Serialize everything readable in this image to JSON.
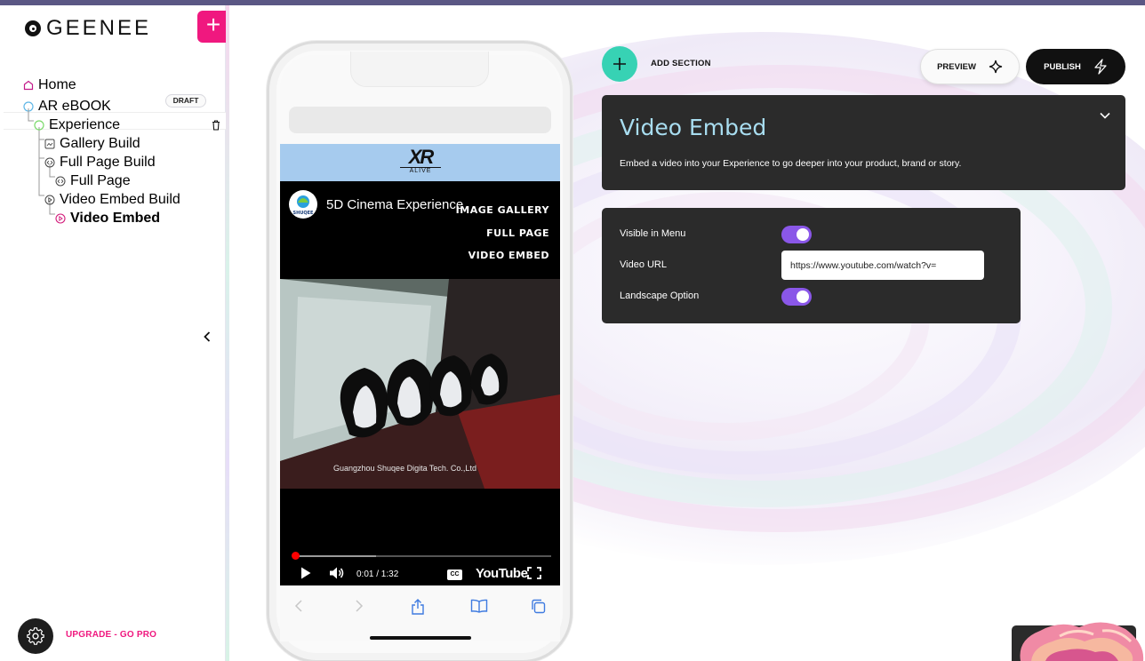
{
  "app": {
    "brand": "GEENEE",
    "add_label": "+"
  },
  "sidebar": {
    "tree": [
      {
        "label": "Home",
        "icon": "home-icon",
        "level": 0
      },
      {
        "label": "AR eBOOK",
        "icon": "circle-icon",
        "level": 0,
        "badge": "DRAFT"
      },
      {
        "label": "Experience",
        "icon": "circle-icon",
        "level": 1,
        "selected": true
      },
      {
        "label": "Gallery Build",
        "icon": "gallery-icon",
        "level": 2
      },
      {
        "label": "Full Page Build",
        "icon": "code-icon",
        "level": 2
      },
      {
        "label": "Full Page",
        "icon": "code-icon",
        "level": 3
      },
      {
        "label": "Video Embed Build",
        "icon": "play-icon",
        "level": 2
      },
      {
        "label": "Video Embed",
        "icon": "play-icon",
        "level": 3,
        "active": true
      }
    ],
    "draft_badge": "DRAFT",
    "upgrade_label": "UPGRADE - GO PRO"
  },
  "phone": {
    "banner_logo": "XR",
    "banner_logo_sub": "ALIVE",
    "video_title": "5D Cinema Experience",
    "menu": [
      "IMAGE GALLERY",
      "FULL PAGE",
      "VIDEO EMBED"
    ],
    "caption": "Guangzhou Shuqee Digita Tech. Co.,Ltd",
    "avatar_text": "SHUQEE",
    "time": "0:01 / 1:32",
    "progress": 0.01,
    "buffered": 0.32,
    "cc_label": "CC",
    "player_brand": "YouTube"
  },
  "toolbar": {
    "add_section_label": "ADD SECTION",
    "preview_label": "PREVIEW",
    "publish_label": "PUBLISH"
  },
  "section": {
    "title": "Video Embed",
    "description": "Embed a video into your Experience to go deeper into your product, brand or story."
  },
  "fields": {
    "visible_in_menu_label": "Visible in Menu",
    "visible_in_menu": true,
    "video_url_label": "Video URL",
    "video_url": "https://www.youtube.com/watch?v=",
    "landscape_label": "Landscape Option",
    "landscape": true
  },
  "colors": {
    "accent_pink": "#f0187f",
    "accent_teal": "#37d2b4",
    "toggle_purple": "#8a57e8",
    "title_blue": "#a8ddf0",
    "panel_dark": "#2b2b2b"
  }
}
